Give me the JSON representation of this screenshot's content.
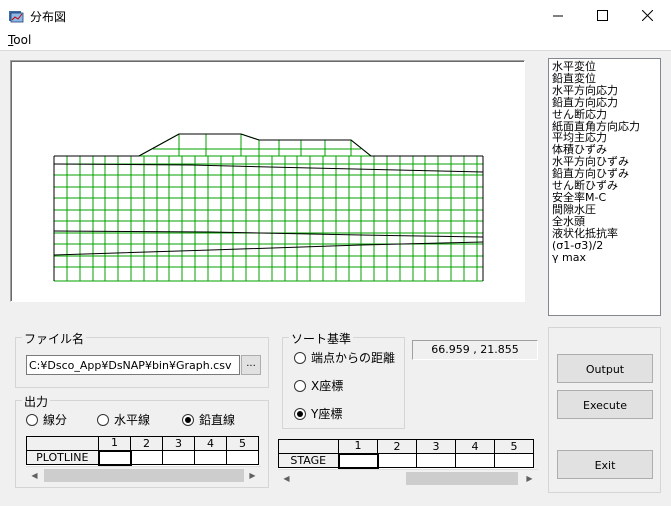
{
  "window": {
    "title": "分布図"
  },
  "menu": {
    "tool_label_ul": "T",
    "tool_label_rest": "ool"
  },
  "plot_types": [
    "水平変位",
    "鉛直変位",
    "水平方向応力",
    "鉛直方向応力",
    "せん断応力",
    "紙面直角方向応力",
    "平均主応力",
    "体積ひずみ",
    "水平方向ひずみ",
    "鉛直方向ひずみ",
    "せん断ひずみ",
    "安全率M-C",
    "間隙水圧",
    "全水頭",
    "液状化抵抗率",
    "(σ1-σ3)/2",
    "γ max"
  ],
  "file_group": {
    "label": "ファイル名",
    "path": "C:¥Dsco_App¥DsNAP¥bin¥Graph.csv",
    "browse_label": "..."
  },
  "output_group": {
    "label": "出力",
    "options": [
      {
        "label": "線分",
        "selected": false
      },
      {
        "label": "水平線",
        "selected": false
      },
      {
        "label": "鉛直線",
        "selected": true
      }
    ]
  },
  "sort_group": {
    "label": "ソート基準",
    "options": [
      {
        "label": "端点からの距離",
        "selected": false
      },
      {
        "label": "X座標",
        "selected": false
      },
      {
        "label": "Y座標",
        "selected": true
      }
    ]
  },
  "coordinates": "66.959 , 21.855",
  "plotline_table": {
    "row_label": "PLOTLINE",
    "columns": [
      "1",
      "2",
      "3",
      "4",
      "5"
    ]
  },
  "stage_table": {
    "row_label": "STAGE",
    "columns": [
      "1",
      "2",
      "3",
      "4",
      "5"
    ]
  },
  "buttons": {
    "output": "Output",
    "execute": "Execute",
    "exit": "Exit"
  },
  "colors": {
    "mesh": "#00a000",
    "outline": "#000000"
  },
  "icons": {
    "app": "app-icon",
    "minimize": "minimize-icon",
    "maximize": "maximize-icon",
    "close": "close-icon",
    "scroll_left": "arrow-left-icon",
    "scroll_right": "arrow-right-icon"
  }
}
